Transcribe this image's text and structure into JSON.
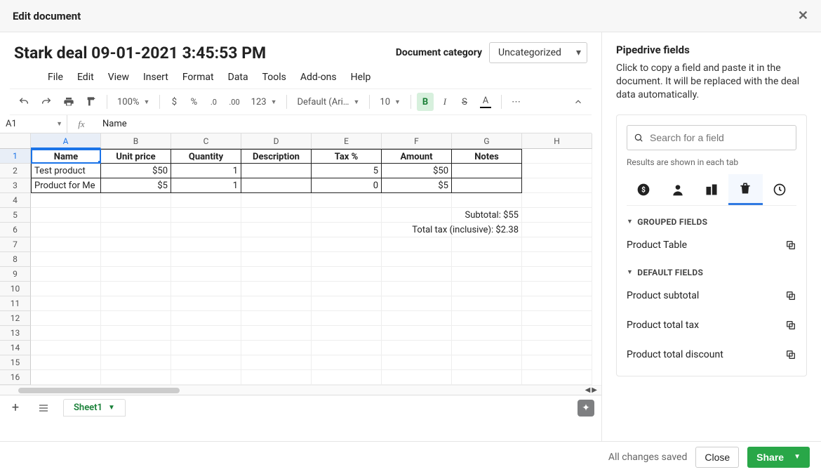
{
  "modal": {
    "title": "Edit document"
  },
  "document": {
    "title": "Stark deal 09-01-2021 3:45:53 PM",
    "category_label": "Document category",
    "category_value": "Uncategorized"
  },
  "menus": [
    "File",
    "Edit",
    "View",
    "Insert",
    "Format",
    "Data",
    "Tools",
    "Add-ons",
    "Help"
  ],
  "toolbar": {
    "zoom": "100%",
    "format_more": "123",
    "font": "Default (Ari…",
    "font_size": "10"
  },
  "formula_bar": {
    "cell_ref": "A1",
    "value": "Name"
  },
  "columns": [
    "A",
    "B",
    "C",
    "D",
    "E",
    "F",
    "G",
    "H"
  ],
  "row_count": 16,
  "table": {
    "headers": [
      "Name",
      "Unit price",
      "Quantity",
      "Description",
      "Tax %",
      "Amount",
      "Notes"
    ],
    "rows": [
      {
        "name": "Test product",
        "unit_price": "$50",
        "quantity": "1",
        "description": "",
        "tax": "5",
        "amount": "$50",
        "notes": ""
      },
      {
        "name": "Product for Me",
        "unit_price": "$5",
        "quantity": "1",
        "description": "",
        "tax": "0",
        "amount": "$5",
        "notes": ""
      }
    ],
    "subtotal_text": "Subtotal: $55",
    "total_tax_text": "Total tax (inclusive): $2.38"
  },
  "sheet_tab": "Sheet1",
  "right_panel": {
    "title": "Pipedrive fields",
    "desc": "Click to copy a field and paste it in the document. It will be replaced with the deal data automatically.",
    "search_placeholder": "Search for a field",
    "results_note": "Results are shown in each tab",
    "grouped_label": "GROUPED FIELDS",
    "grouped_fields": [
      "Product Table"
    ],
    "default_label": "DEFAULT FIELDS",
    "default_fields": [
      "Product subtotal",
      "Product total tax",
      "Product total discount"
    ]
  },
  "footer": {
    "saved": "All changes saved",
    "close": "Close",
    "share": "Share"
  }
}
